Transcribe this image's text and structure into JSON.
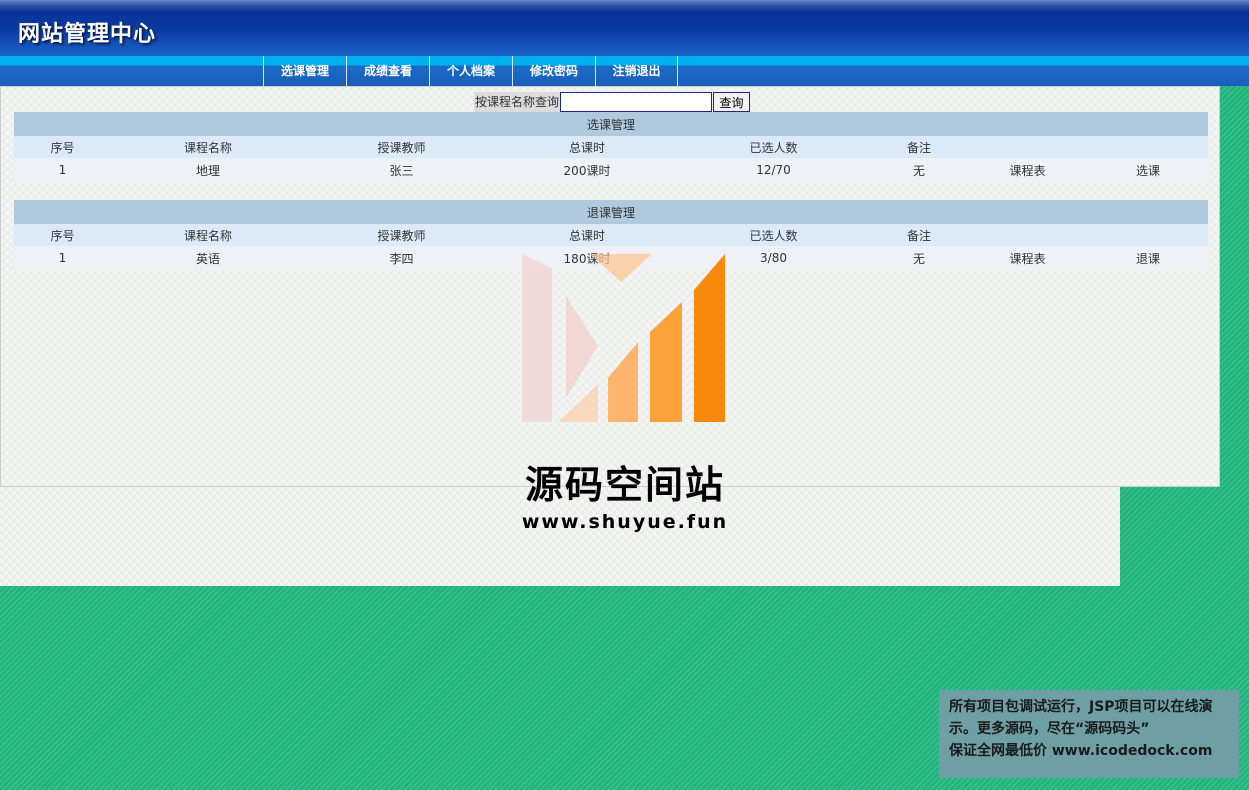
{
  "header": {
    "title": "网站管理中心"
  },
  "nav": [
    {
      "label": "选课管理"
    },
    {
      "label": "成绩查看"
    },
    {
      "label": "个人档案"
    },
    {
      "label": "修改密码"
    },
    {
      "label": "注销退出"
    }
  ],
  "search": {
    "label": "按课程名称查询",
    "value": "",
    "button": "查询"
  },
  "select_section": {
    "caption": "选课管理",
    "columns": [
      "序号",
      "课程名称",
      "授课教师",
      "总课时",
      "已选人数",
      "备注",
      "",
      ""
    ],
    "rows": [
      [
        "1",
        "地理",
        "张三",
        "200课时",
        "12/70",
        "无",
        "课程表",
        "选课"
      ]
    ]
  },
  "drop_section": {
    "caption": "退课管理",
    "columns": [
      "序号",
      "课程名称",
      "授课教师",
      "总课时",
      "已选人数",
      "备注",
      "",
      ""
    ],
    "rows": [
      [
        "1",
        "英语",
        "李四",
        "180课时",
        "3/80",
        "无",
        "课程表",
        "退课"
      ]
    ]
  },
  "watermark": {
    "name": "源码空间站",
    "url": "www.shuyue.fun"
  },
  "promo": {
    "line1": "所有项目包调试运行，JSP项目可以在线演",
    "line2": "示。更多源码，尽在“源码码头”",
    "line3": "保证全网最低价 www.icodedock.com"
  },
  "colors": {
    "page_background": "#1fb57d",
    "header_blue": "#0a3396",
    "nav_accent": "#00b0ee",
    "table_caption": "#afc9df",
    "table_header": "#dbeaf9",
    "table_row": "#eff1f7",
    "watermark_orange": "#f7890d"
  }
}
